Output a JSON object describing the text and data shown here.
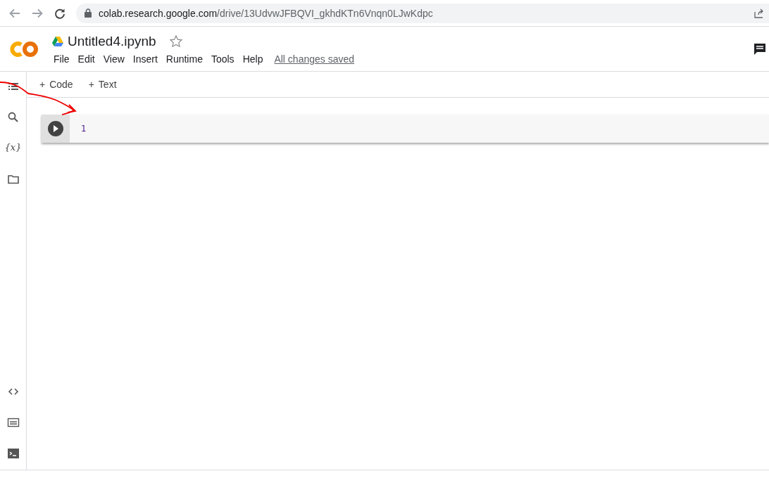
{
  "browser": {
    "url_host": "colab.research.google.com",
    "url_path": "/drive/13UdvwJFBQVI_gkhdKTn6Vnqn0LJwKdpc"
  },
  "header": {
    "notebook_title": "Untitled4.ipynb",
    "starred": false,
    "menu": [
      "File",
      "Edit",
      "View",
      "Insert",
      "Runtime",
      "Tools",
      "Help"
    ],
    "save_status": "All changes saved"
  },
  "toolbar": {
    "buttons": [
      {
        "icon": "+",
        "label": "Code"
      },
      {
        "icon": "+",
        "label": "Text"
      }
    ]
  },
  "sidebar": {
    "top": [
      {
        "kind": "toc"
      },
      {
        "kind": "search"
      },
      {
        "kind": "variables",
        "text": "{x}"
      },
      {
        "kind": "files"
      }
    ],
    "bottom": [
      {
        "kind": "snippets"
      },
      {
        "kind": "command"
      },
      {
        "kind": "terminal"
      }
    ]
  },
  "cells": [
    {
      "line_numbers": [
        "1"
      ]
    }
  ]
}
